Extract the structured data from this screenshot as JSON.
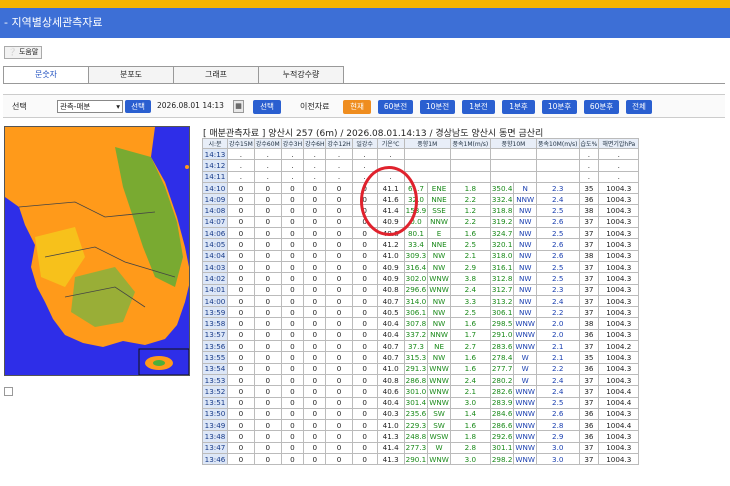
{
  "app": {
    "title": "- 지역별상세관측자료"
  },
  "help_label": "도움말",
  "tabs": [
    "문숫자",
    "분포도",
    "그래프",
    "누적강수량"
  ],
  "controls": {
    "select_label": "선택",
    "select_value": "관측-매분",
    "select_btn": "선택",
    "datetime": "2026.08.01  14:13",
    "choose_btn": "선택",
    "prev_label": "이전자료",
    "now_btn": "현재",
    "nav": [
      "60분전",
      "10분전",
      "1분전",
      "1분후",
      "10분후",
      "60분후",
      "전체"
    ]
  },
  "heading": "[ 매분관측자료 ] 양산시 257 (6m) / 2026.08.01.14:13 / 경상남도 양산시 동면 금산리",
  "columns": [
    "시:분",
    "강수15M",
    "강수60M",
    "강수3H",
    "강수6H",
    "강수12H",
    "일강수",
    "기온℃",
    "풍향1M",
    "풍속1M(m/s)",
    "풍향10M",
    "풍속10M(m/s)",
    "습도%",
    "해면기압hPa"
  ],
  "rows": [
    [
      "14:13",
      ".",
      ".",
      ".",
      ".",
      ".",
      ".",
      ".",
      "",
      "",
      "",
      "",
      ".",
      "."
    ],
    [
      "14:12",
      ".",
      ".",
      ".",
      ".",
      ".",
      ".",
      ".",
      "",
      "",
      "",
      "",
      ".",
      "."
    ],
    [
      "14:11",
      ".",
      ".",
      ".",
      ".",
      ".",
      ".",
      ".",
      "",
      "",
      "",
      "",
      ".",
      "."
    ],
    [
      "14:10",
      "0",
      "0",
      "0",
      "0",
      "0",
      "0",
      "41.1",
      "61.7",
      "ENE",
      "1.8",
      "350.4",
      "N",
      "2.3",
      "35",
      "1004.3"
    ],
    [
      "14:09",
      "0",
      "0",
      "0",
      "0",
      "0",
      "0",
      "41.6",
      "32.0",
      "NNE",
      "2.2",
      "332.4",
      "NNW",
      "2.4",
      "36",
      "1004.3"
    ],
    [
      "14:08",
      "0",
      "0",
      "0",
      "0",
      "0",
      "0",
      "41.4",
      "153.9",
      "SSE",
      "1.2",
      "318.8",
      "NW",
      "2.5",
      "38",
      "1004.3"
    ],
    [
      "14:07",
      "0",
      "0",
      "0",
      "0",
      "0",
      "0",
      "40.9",
      "0.0",
      "NNW",
      "2.2",
      "319.2",
      "NW",
      "2.6",
      "37",
      "1004.3"
    ],
    [
      "14:06",
      "0",
      "0",
      "0",
      "0",
      "0",
      "0",
      "40.8",
      "80.1",
      "E",
      "1.6",
      "324.7",
      "NW",
      "2.5",
      "37",
      "1004.3"
    ],
    [
      "14:05",
      "0",
      "0",
      "0",
      "0",
      "0",
      "0",
      "41.2",
      "33.4",
      "NNE",
      "2.5",
      "320.1",
      "NW",
      "2.6",
      "37",
      "1004.3"
    ],
    [
      "14:04",
      "0",
      "0",
      "0",
      "0",
      "0",
      "0",
      "41.0",
      "309.3",
      "NW",
      "2.1",
      "318.0",
      "NW",
      "2.6",
      "38",
      "1004.3"
    ],
    [
      "14:03",
      "0",
      "0",
      "0",
      "0",
      "0",
      "0",
      "40.9",
      "316.4",
      "NW",
      "2.9",
      "316.1",
      "NW",
      "2.5",
      "37",
      "1004.3"
    ],
    [
      "14:02",
      "0",
      "0",
      "0",
      "0",
      "0",
      "0",
      "40.9",
      "302.0",
      "WNW",
      "3.8",
      "312.8",
      "NW",
      "2.5",
      "37",
      "1004.3"
    ],
    [
      "14:01",
      "0",
      "0",
      "0",
      "0",
      "0",
      "0",
      "40.8",
      "296.6",
      "WNW",
      "2.4",
      "312.7",
      "NW",
      "2.3",
      "37",
      "1004.3"
    ],
    [
      "14:00",
      "0",
      "0",
      "0",
      "0",
      "0",
      "0",
      "40.7",
      "314.0",
      "NW",
      "3.3",
      "313.2",
      "NW",
      "2.4",
      "37",
      "1004.3"
    ],
    [
      "13:59",
      "0",
      "0",
      "0",
      "0",
      "0",
      "0",
      "40.5",
      "306.1",
      "NW",
      "2.5",
      "306.1",
      "NW",
      "2.2",
      "37",
      "1004.3"
    ],
    [
      "13:58",
      "0",
      "0",
      "0",
      "0",
      "0",
      "0",
      "40.4",
      "307.8",
      "NW",
      "1.6",
      "298.5",
      "WNW",
      "2.0",
      "38",
      "1004.3"
    ],
    [
      "13:57",
      "0",
      "0",
      "0",
      "0",
      "0",
      "0",
      "40.4",
      "337.2",
      "NNW",
      "1.7",
      "291.0",
      "WNW",
      "2.0",
      "36",
      "1004.3"
    ],
    [
      "13:56",
      "0",
      "0",
      "0",
      "0",
      "0",
      "0",
      "40.7",
      "37.3",
      "NE",
      "2.7",
      "283.6",
      "WNW",
      "2.1",
      "37",
      "1004.2"
    ],
    [
      "13:55",
      "0",
      "0",
      "0",
      "0",
      "0",
      "0",
      "40.7",
      "315.3",
      "NW",
      "1.6",
      "278.4",
      "W",
      "2.1",
      "35",
      "1004.3"
    ],
    [
      "13:54",
      "0",
      "0",
      "0",
      "0",
      "0",
      "0",
      "41.0",
      "291.3",
      "WNW",
      "1.6",
      "277.7",
      "W",
      "2.2",
      "36",
      "1004.3"
    ],
    [
      "13:53",
      "0",
      "0",
      "0",
      "0",
      "0",
      "0",
      "40.8",
      "286.8",
      "WNW",
      "2.4",
      "280.2",
      "W",
      "2.4",
      "37",
      "1004.3"
    ],
    [
      "13:52",
      "0",
      "0",
      "0",
      "0",
      "0",
      "0",
      "40.6",
      "301.0",
      "WNW",
      "2.1",
      "282.6",
      "WNW",
      "2.4",
      "37",
      "1004.4"
    ],
    [
      "13:51",
      "0",
      "0",
      "0",
      "0",
      "0",
      "0",
      "40.4",
      "301.4",
      "WNW",
      "3.0",
      "283.9",
      "WNW",
      "2.5",
      "37",
      "1004.4"
    ],
    [
      "13:50",
      "0",
      "0",
      "0",
      "0",
      "0",
      "0",
      "40.3",
      "235.6",
      "SW",
      "1.4",
      "284.6",
      "WNW",
      "2.6",
      "36",
      "1004.3"
    ],
    [
      "13:49",
      "0",
      "0",
      "0",
      "0",
      "0",
      "0",
      "41.0",
      "229.3",
      "SW",
      "1.6",
      "286.6",
      "WNW",
      "2.8",
      "36",
      "1004.4"
    ],
    [
      "13:48",
      "0",
      "0",
      "0",
      "0",
      "0",
      "0",
      "41.3",
      "248.8",
      "WSW",
      "1.8",
      "292.6",
      "WNW",
      "2.9",
      "36",
      "1004.3"
    ],
    [
      "13:47",
      "0",
      "0",
      "0",
      "0",
      "0",
      "0",
      "41.4",
      "277.3",
      "W",
      "2.8",
      "301.1",
      "WNW",
      "3.0",
      "37",
      "1004.3"
    ],
    [
      "13:46",
      "0",
      "0",
      "0",
      "0",
      "0",
      "0",
      "41.3",
      "290.1",
      "WNW",
      "3.0",
      "298.2",
      "WNW",
      "3.0",
      "37",
      "1004.3"
    ]
  ],
  "colors": {
    "accent": "#3d6fd6",
    "stripe": "#f5b400",
    "annotation": "#e0222d"
  }
}
